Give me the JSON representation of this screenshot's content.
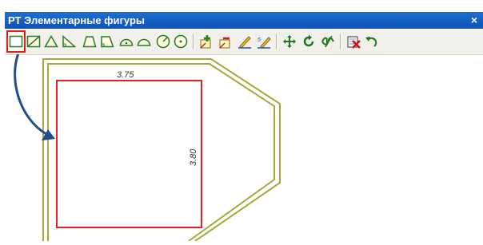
{
  "window": {
    "title": "РТ Элементарные фигуры",
    "close_glyph": "×"
  },
  "toolbar": {
    "buttons": [
      {
        "name": "rectangle-tool-icon",
        "active": true
      },
      {
        "name": "rectangle-diagonal-tool-icon"
      },
      {
        "name": "triangle-tool-icon"
      },
      {
        "name": "right-triangle-tool-icon"
      },
      {
        "name": "trapezoid-tool-icon"
      },
      {
        "name": "right-trapezoid-tool-icon"
      },
      {
        "name": "half-circle-center-tool-icon"
      },
      {
        "name": "arc-tool-icon"
      },
      {
        "name": "circle-radius-tool-icon"
      },
      {
        "name": "circle-center-tool-icon"
      },
      {
        "name": "insert-point-icon"
      },
      {
        "name": "delete-point-icon"
      },
      {
        "name": "edit-dimension-icon"
      },
      {
        "name": "edit-all-dimensions-icon"
      },
      {
        "name": "move-icon"
      },
      {
        "name": "rotate-icon"
      },
      {
        "name": "mirror-icon"
      },
      {
        "name": "delete-shape-icon"
      },
      {
        "name": "undo-icon"
      }
    ]
  },
  "drawing": {
    "width_label": "3.75",
    "height_label": "3.80",
    "colors": {
      "shape": "#e82020",
      "offset": "#a8a83a",
      "arrow": "#1f4f8a"
    }
  }
}
